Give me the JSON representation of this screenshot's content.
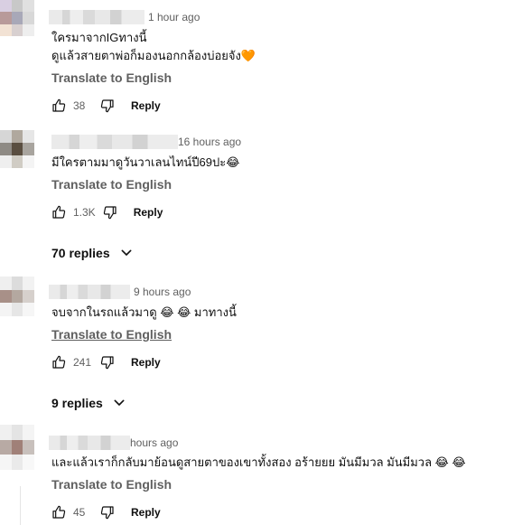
{
  "comments": [
    {
      "time": "1 hour ago",
      "lines": [
        "ใครมาจากIGทางนี้",
        "ดูแล้วสายตาพ่อก็มองนอกกล้องบ่อยจัง"
      ],
      "emoji": "🧡",
      "translate": "Translate to English",
      "likes": "38",
      "reply": "Reply"
    },
    {
      "time": "16 hours ago",
      "lines": [
        "มีใครตามมาดูวันวาเลนไทน์ปี69ปะ😂"
      ],
      "translate": "Translate to English",
      "likes": "1.3K",
      "reply": "Reply",
      "replies": "70 replies"
    },
    {
      "time": "9 hours ago",
      "lines": [
        "จบจากในรถแล้วมาดู 😂 😂 มาทางนี้"
      ],
      "translate": "Translate to English",
      "likes": "241",
      "reply": "Reply",
      "replies": "9 replies"
    },
    {
      "time": "hours ago",
      "lines": [
        "และแล้วเราก็กลับมาย้อนดูสายตาของเขาทั้งสอง อร้ายยย มันมีมวล มันมีมวล 😂 😂"
      ],
      "translate": "Translate to English",
      "likes": "45",
      "reply": "Reply"
    }
  ],
  "icons": {
    "like": "thumbs-up-icon",
    "dislike": "thumbs-down-icon",
    "expand": "chevron-down-icon"
  }
}
